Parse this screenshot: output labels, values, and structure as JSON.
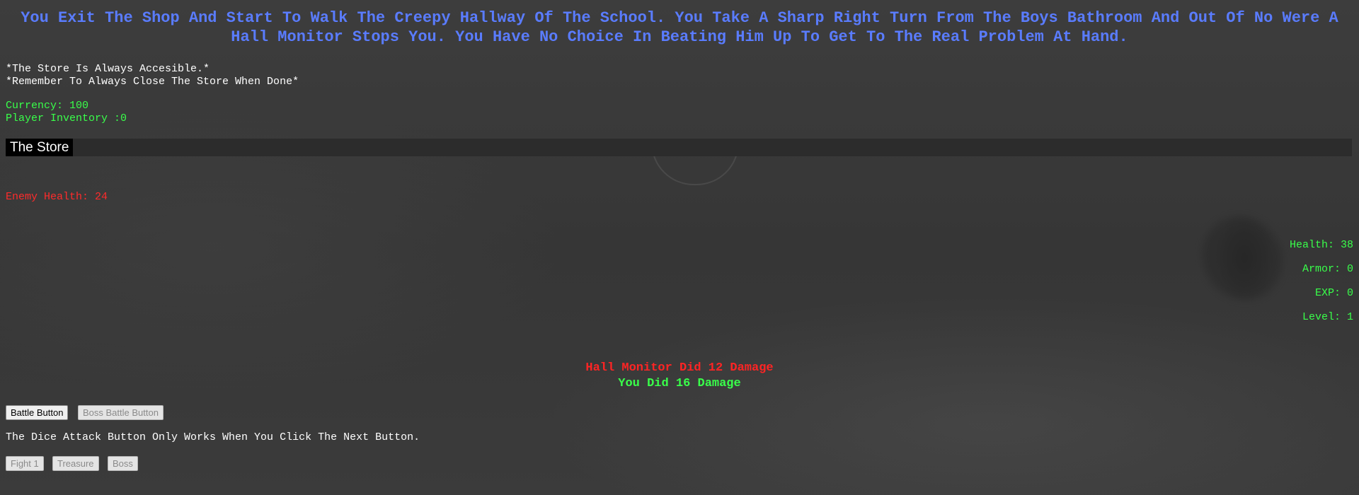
{
  "story_text": "You Exit The Shop And Start To Walk The Creepy Hallway Of The School. You Take A Sharp Right Turn From The Boys Bathroom And Out Of No Were A Hall Monitor Stops You. You Have No Choice In Beating Him Up To Get To The Real Problem At Hand.",
  "notices": {
    "store_accessible": "*The Store Is Always Accesible.*",
    "close_store": "*Remember To Always Close The Store When Done*"
  },
  "player": {
    "currency": "Currency: 100",
    "inventory": "Player Inventory :0",
    "health": "Health: 38",
    "armor": "Armor: 0",
    "exp": "EXP: 0",
    "level": "Level: 1"
  },
  "store": {
    "label": "The Store"
  },
  "enemy": {
    "health": "Enemy Health: 24"
  },
  "battle_log": {
    "enemy_damage": "Hall Monitor Did 12 Damage",
    "player_damage": "You Did 16 Damage"
  },
  "buttons": {
    "battle": "Battle Button",
    "boss_battle": "Boss Battle Button",
    "fight1": "Fight 1",
    "treasure": "Treasure",
    "boss": "Boss"
  },
  "hint": "The Dice Attack Button Only Works When You Click The Next Button.",
  "colors": {
    "story": "#5a7cff",
    "stats": "#39ff4a",
    "enemy": "#ff2b2b",
    "background": "#3a3a3a"
  }
}
